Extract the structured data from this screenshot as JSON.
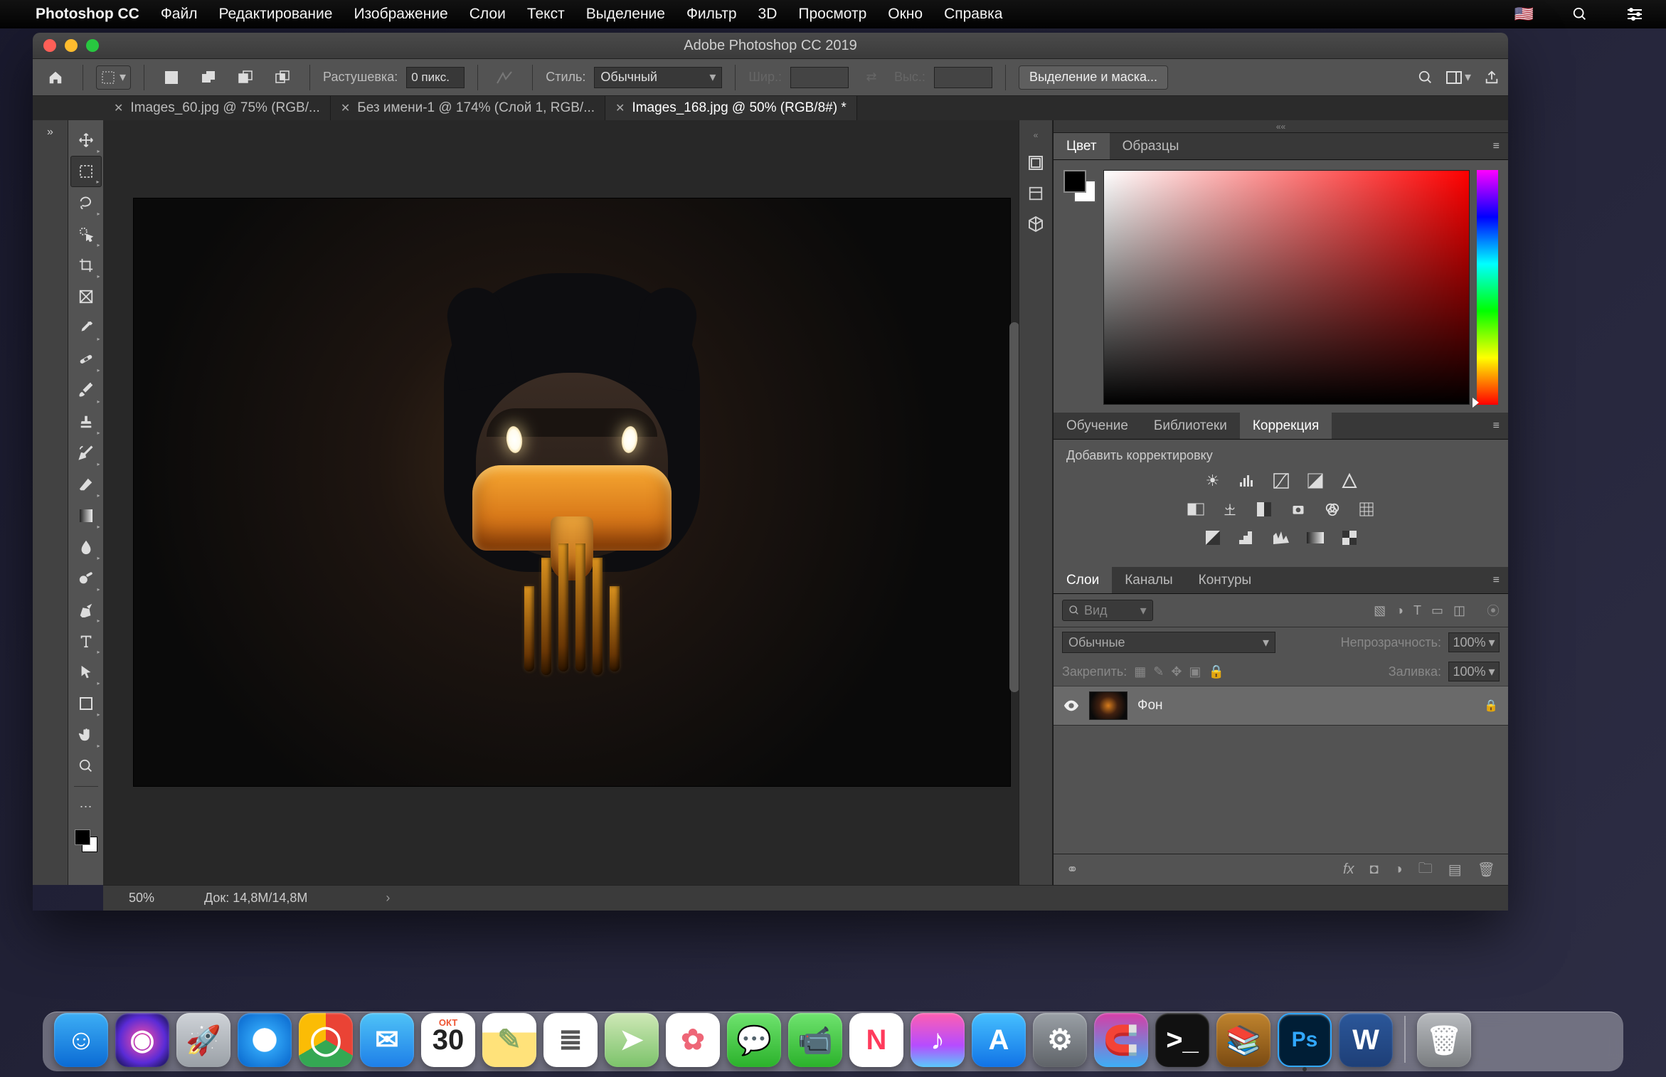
{
  "mac_menu": {
    "app": "Photoshop CC",
    "items": [
      "Файл",
      "Редактирование",
      "Изображение",
      "Слои",
      "Текст",
      "Выделение",
      "Фильтр",
      "3D",
      "Просмотр",
      "Окно",
      "Справка"
    ]
  },
  "window": {
    "title": "Adobe Photoshop CC 2019"
  },
  "options_bar": {
    "feather_label": "Растушевка:",
    "feather_value": "0 пикс.",
    "style_label": "Стиль:",
    "style_value": "Обычный",
    "width_label": "Шир.:",
    "height_label": "Выс.:",
    "select_mask": "Выделение и маска..."
  },
  "tabs": [
    {
      "label": "Images_60.jpg @ 75% (RGB/...",
      "active": false
    },
    {
      "label": "Без имени-1 @ 174% (Слой 1, RGB/...",
      "active": false
    },
    {
      "label": "Images_168.jpg @ 50% (RGB/8#) *",
      "active": true
    }
  ],
  "status": {
    "zoom": "50%",
    "doc": "Док: 14,8M/14,8M"
  },
  "panel_color": {
    "tab1": "Цвет",
    "tab2": "Образцы"
  },
  "panel_learn": {
    "tab1": "Обучение",
    "tab2": "Библиотеки",
    "tab3": "Коррекция",
    "add": "Добавить корректировку"
  },
  "panel_layers": {
    "tab1": "Слои",
    "tab2": "Каналы",
    "tab3": "Контуры",
    "search": "Вид",
    "blend": "Обычные",
    "opacity_label": "Непрозрачность:",
    "opacity_val": "100%",
    "lock_label": "Закрепить:",
    "fill_label": "Заливка:",
    "fill_val": "100%",
    "layer0": "Фон"
  },
  "dock": [
    {
      "name": "finder",
      "bg": "linear-gradient(#3daef5,#0b6bd4)",
      "glyph": "☺"
    },
    {
      "name": "siri",
      "bg": "radial-gradient(circle,#ff4fa3,#5a2bd6 60%,#071033)",
      "glyph": "◉"
    },
    {
      "name": "launchpad",
      "bg": "linear-gradient(#cfd3d8,#9aa0a6)",
      "glyph": "🚀"
    },
    {
      "name": "safari",
      "bg": "radial-gradient(circle,#fff 30%,#2da0f3 32%,#0561c9)",
      "glyph": "✦"
    },
    {
      "name": "chrome",
      "bg": "conic-gradient(#ea4335 0 120deg,#34a853 120deg 240deg,#fbbc05 240deg 360deg)",
      "glyph": "◯"
    },
    {
      "name": "mail",
      "bg": "linear-gradient(#4fc3f7,#1e7fe8)",
      "glyph": "✉"
    },
    {
      "name": "calendar",
      "bg": "#fff",
      "glyph": "30",
      "text": "#222",
      "badge": "ОКТ"
    },
    {
      "name": "notes",
      "bg": "linear-gradient(#fff 36%,#ffe27a 36%)",
      "glyph": "✎",
      "text": "#8a6"
    },
    {
      "name": "reminders",
      "bg": "#fff",
      "glyph": "≣",
      "text": "#555"
    },
    {
      "name": "maps",
      "bg": "linear-gradient(#cfe8b7,#7cc36a)",
      "glyph": "➤"
    },
    {
      "name": "photos",
      "bg": "#fff",
      "glyph": "✿",
      "text": "#e67"
    },
    {
      "name": "messages",
      "bg": "linear-gradient(#6fe36f,#2bb22b)",
      "glyph": "💬"
    },
    {
      "name": "facetime",
      "bg": "linear-gradient(#6fe36f,#2bb22b)",
      "glyph": "📹"
    },
    {
      "name": "news",
      "bg": "#fff",
      "glyph": "N",
      "text": "#ff3b5c"
    },
    {
      "name": "itunes",
      "bg": "linear-gradient(#ff5fb0,#b64cff 60%,#5ac8fa)",
      "glyph": "♪"
    },
    {
      "name": "appstore",
      "bg": "linear-gradient(#46c0ff,#1173e6)",
      "glyph": "A"
    },
    {
      "name": "settings",
      "bg": "linear-gradient(#9aa0a6,#5f6368)",
      "glyph": "⚙"
    },
    {
      "name": "magnet",
      "bg": "linear-gradient(#d63da6,#3daef5)",
      "glyph": "🧲"
    },
    {
      "name": "terminal",
      "bg": "#111",
      "glyph": ">_"
    },
    {
      "name": "books",
      "bg": "linear-gradient(#c0842e,#7a4a12)",
      "glyph": "📚"
    },
    {
      "name": "photoshop",
      "bg": "#001e36",
      "glyph": "Ps",
      "text": "#31a8ff",
      "active": true
    },
    {
      "name": "word",
      "bg": "linear-gradient(#2b579a,#1e3f77)",
      "glyph": "W"
    },
    {
      "name": "trash",
      "bg": "linear-gradient(#b8bbbf,#7a7d80)",
      "glyph": "🗑"
    }
  ]
}
